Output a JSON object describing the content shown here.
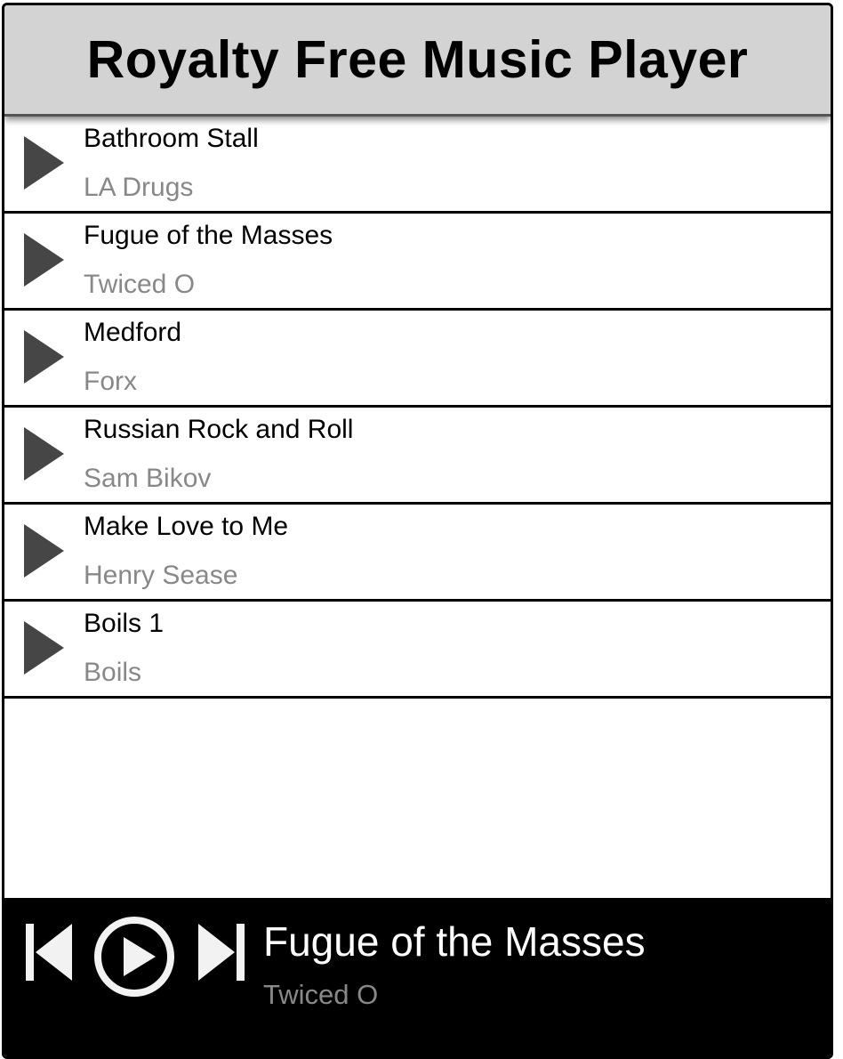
{
  "app": {
    "title": "Royalty Free Music Player"
  },
  "tracks": [
    {
      "title": "Bathroom Stall",
      "artist": "LA Drugs"
    },
    {
      "title": "Fugue of the Masses",
      "artist": "Twiced O"
    },
    {
      "title": "Medford",
      "artist": "Forx"
    },
    {
      "title": "Russian Rock and Roll",
      "artist": "Sam Bikov"
    },
    {
      "title": "Make Love to Me",
      "artist": "Henry Sease"
    },
    {
      "title": "Boils 1",
      "artist": "Boils"
    }
  ],
  "now_playing": {
    "title": "Fugue of the Masses",
    "artist": "Twiced O"
  },
  "icons": {
    "track_play": "play-triangle-icon",
    "prev": "skip-previous-icon",
    "play": "play-circle-icon",
    "next": "skip-next-icon"
  },
  "colors": {
    "header_bg": "#d3d3d3",
    "border": "#000000",
    "play_triangle": "#464646",
    "artist_text": "#888888",
    "now_playing_bar": "#000000",
    "now_playing_text": "#ffffff"
  }
}
